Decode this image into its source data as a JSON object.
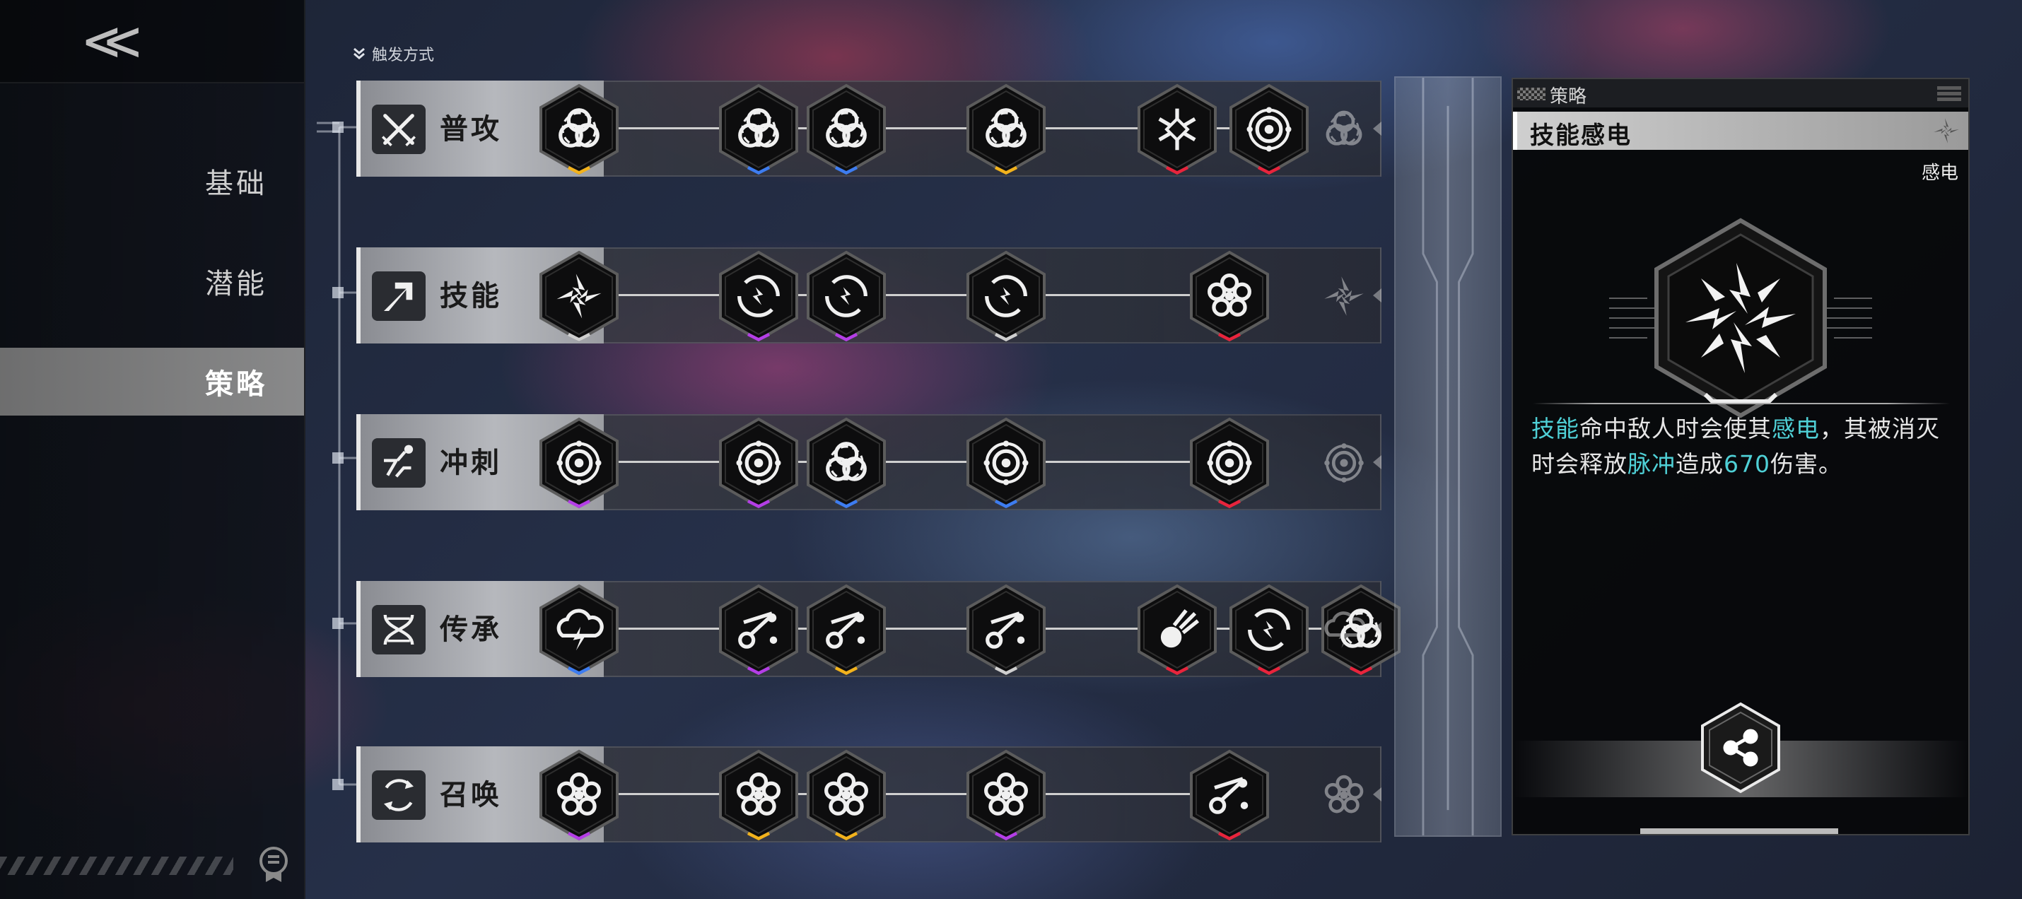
{
  "nav": {
    "items": [
      {
        "label": "基础",
        "active": false
      },
      {
        "label": "潜能",
        "active": false
      },
      {
        "label": "策略",
        "active": true
      }
    ]
  },
  "trigger": {
    "label": "触发方式"
  },
  "rows": [
    {
      "label": "普攻",
      "icon": "cross-swords-icon",
      "nodes": [
        {
          "icon": "biohazard-icon",
          "tier": "yellow"
        },
        {
          "icon": "biohazard-icon",
          "tier": "blue"
        },
        {
          "icon": "biohazard-icon",
          "tier": "blue"
        },
        {
          "icon": "biohazard-icon",
          "tier": "yellow"
        },
        {
          "icon": "frost-icon",
          "tier": "red"
        },
        {
          "icon": "target-icon",
          "tier": "red"
        }
      ]
    },
    {
      "label": "技能",
      "icon": "arrow-dash-icon",
      "nodes": [
        {
          "icon": "shock-icon",
          "tier": "white"
        },
        {
          "icon": "vortex-icon",
          "tier": "purple"
        },
        {
          "icon": "vortex-icon",
          "tier": "purple"
        },
        {
          "icon": "vortex-icon",
          "tier": "white"
        },
        {
          "icon": "flower-icon",
          "tier": "red"
        }
      ]
    },
    {
      "label": "冲刺",
      "icon": "dash-runner-icon",
      "nodes": [
        {
          "icon": "target-icon",
          "tier": "purple"
        },
        {
          "icon": "target-icon",
          "tier": "purple"
        },
        {
          "icon": "biohazard-icon",
          "tier": "blue"
        },
        {
          "icon": "target-icon",
          "tier": "blue"
        },
        {
          "icon": "target-icon",
          "tier": "red"
        }
      ]
    },
    {
      "label": "传承",
      "icon": "dna-icon",
      "nodes": [
        {
          "icon": "thunder-cloud-icon",
          "tier": "blue"
        },
        {
          "icon": "chain-icon",
          "tier": "purple"
        },
        {
          "icon": "chain-icon",
          "tier": "yellow"
        },
        {
          "icon": "chain-icon",
          "tier": "white"
        },
        {
          "icon": "comet-icon",
          "tier": "red"
        },
        {
          "icon": "vortex-icon",
          "tier": "red"
        },
        {
          "icon": "biohazard-icon",
          "tier": "red"
        }
      ]
    },
    {
      "label": "召唤",
      "icon": "summon-icon",
      "nodes": [
        {
          "icon": "flower-icon",
          "tier": "purple"
        },
        {
          "icon": "flower-icon",
          "tier": "yellow"
        },
        {
          "icon": "flower-icon",
          "tier": "yellow"
        },
        {
          "icon": "flower-icon",
          "tier": "purple"
        },
        {
          "icon": "chain-icon",
          "tier": "red"
        }
      ]
    }
  ],
  "panel": {
    "tag": "策略",
    "title": "技能感电",
    "badge": "感电",
    "icon": "shock-icon",
    "desc": [
      {
        "t": "技能",
        "hl": true
      },
      {
        "t": "命中敌人时会使其",
        "hl": false
      },
      {
        "t": "感电",
        "hl": true
      },
      {
        "t": "，其被消灭时会释放",
        "hl": false
      },
      {
        "t": "脉冲",
        "hl": true
      },
      {
        "t": "造成",
        "hl": false
      },
      {
        "t": "670",
        "hl": true
      },
      {
        "t": "伤害。",
        "hl": false
      }
    ],
    "share_icon": "share-icon"
  },
  "colors": {
    "yellow": "#f2b21c",
    "blue": "#3d7cf0",
    "purple": "#b43ee6",
    "red": "#e8243c",
    "white": "#cfcfcf",
    "highlight": "#4fd0d6"
  }
}
